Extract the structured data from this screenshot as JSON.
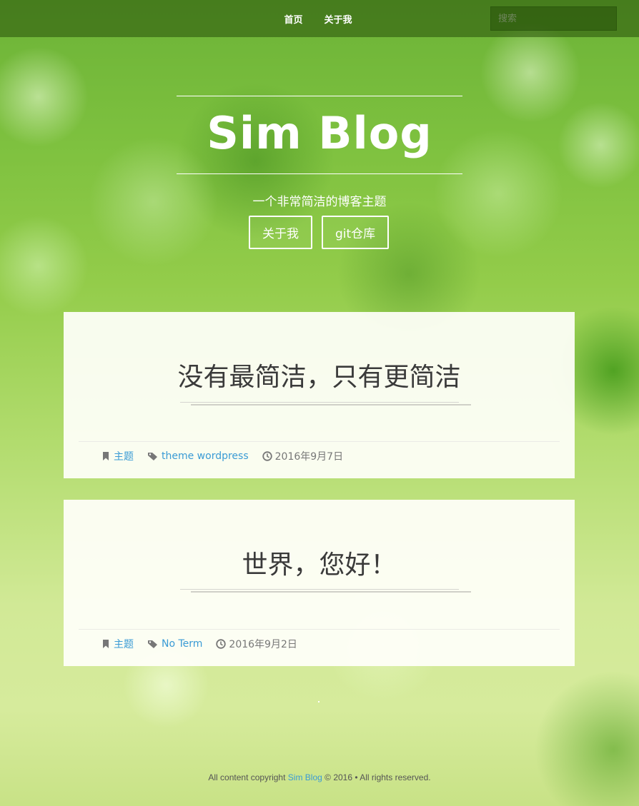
{
  "nav": {
    "links": [
      "首页",
      "关于我"
    ],
    "search_placeholder": "搜索"
  },
  "hero": {
    "title": "Sim Blog",
    "tagline": "一个非常简洁的博客主题",
    "buttons": [
      "关于我",
      "git仓库"
    ]
  },
  "posts": [
    {
      "title": "没有最简洁，只有更简洁",
      "category": "主题",
      "tags": "theme wordpress",
      "date": "2016年9月7日"
    },
    {
      "title": "世界，您好！",
      "category": "主题",
      "tags": "No Term",
      "date": "2016年9月2日"
    }
  ],
  "footer": {
    "prefix": "All content copyright",
    "site": "Sim Blog",
    "suffix": "© 2016 • All rights reserved."
  },
  "colors": {
    "link": "#3a9bd5",
    "nav_bg": "rgba(40,80,10,0.55)",
    "card_bg": "#fffffa"
  },
  "icons": [
    "bookmark-icon",
    "tag-icon",
    "clock-icon"
  ]
}
